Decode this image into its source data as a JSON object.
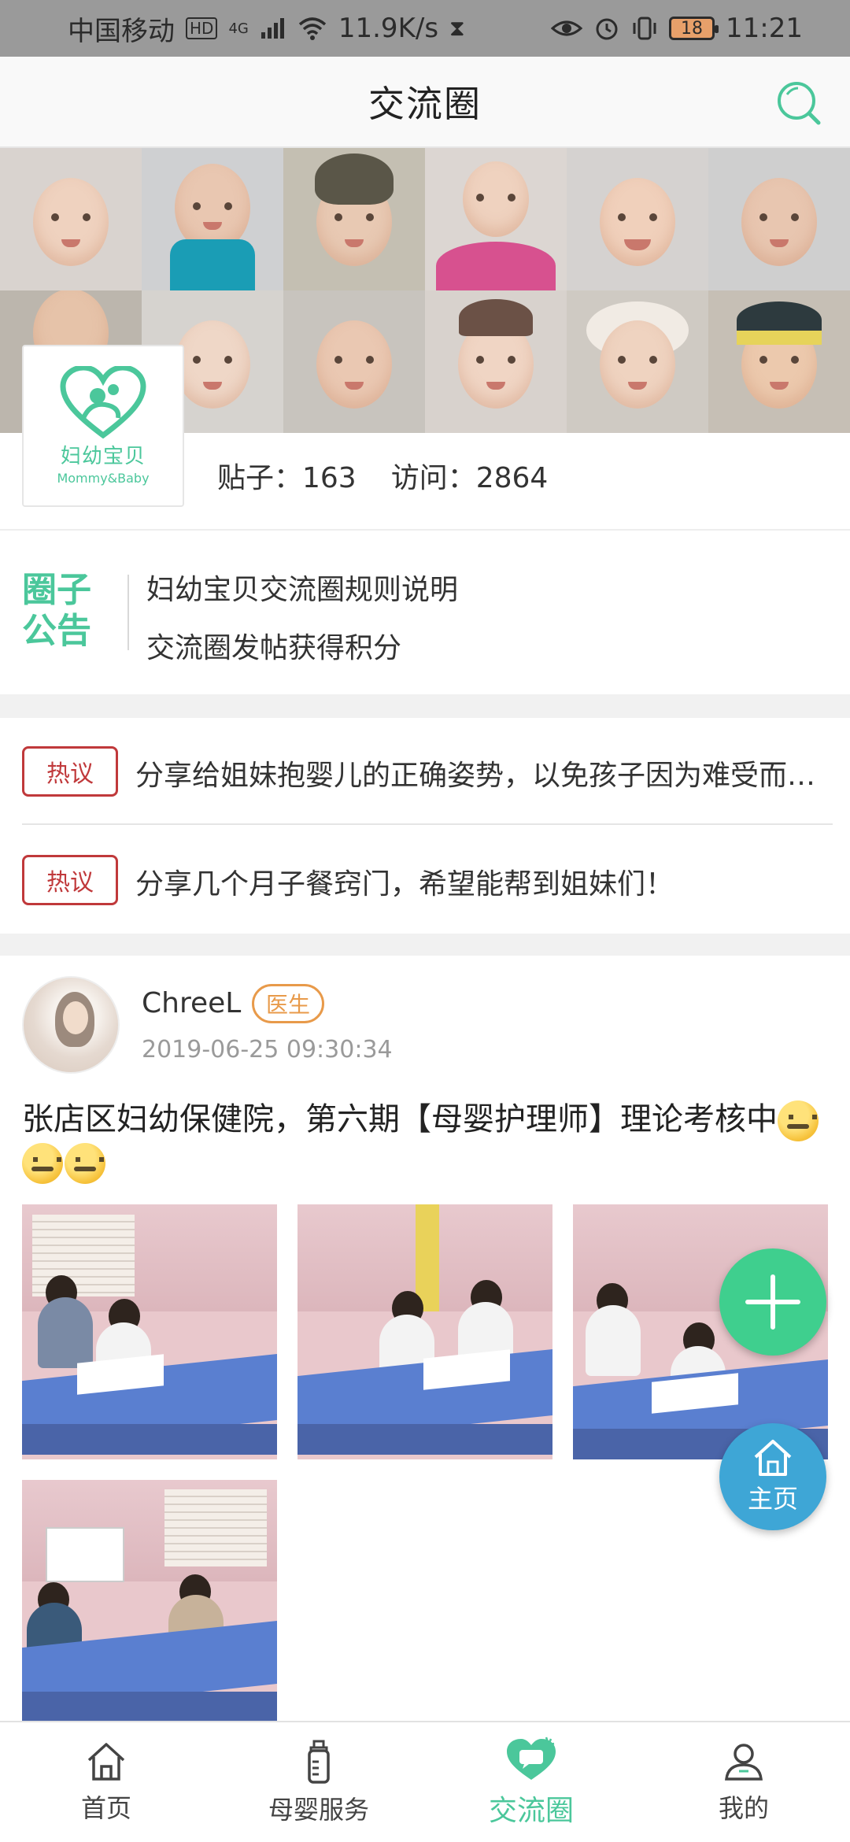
{
  "status_bar": {
    "carrier": "中国移动",
    "hd": "HD",
    "network": "4G",
    "speed": "11.9K/s",
    "battery": "18",
    "time": "11:21"
  },
  "header": {
    "title": "交流圈"
  },
  "circle": {
    "logo_cn": "妇幼宝贝",
    "logo_en": "Mommy&Baby",
    "posts_label": "贴子：163",
    "visits_label": "访问：2864"
  },
  "notice": {
    "tag_line1": "圈子",
    "tag_line2": "公告",
    "items": [
      "妇幼宝贝交流圈规则说明",
      "交流圈发帖获得积分"
    ]
  },
  "hot": {
    "badge": "热议",
    "items": [
      "分享给姐妹抱婴儿的正确姿势，以免孩子因为难受而哭闹",
      "分享几个月子餐窍门，希望能帮到姐妹们！"
    ]
  },
  "post": {
    "username": "ChreeL",
    "role": "医生",
    "time": "2019-06-25 09:30:34",
    "text": "张店区妇幼保健院，第六期【母婴护理师】理论考核中"
  },
  "fab": {
    "home_label": "主页"
  },
  "bottom_nav": {
    "items": [
      {
        "label": "首页",
        "icon": "home-icon"
      },
      {
        "label": "母婴服务",
        "icon": "baby-bottle-icon"
      },
      {
        "label": "交流圈",
        "icon": "chat-heart-icon"
      },
      {
        "label": "我的",
        "icon": "user-icon"
      }
    ],
    "active_index": 2
  },
  "colors": {
    "brand_green": "#4bc79b",
    "hot_red": "#c0393b",
    "doctor_orange": "#e89a4a",
    "fab_add": "#3fcf8e",
    "fab_home": "#3ea6d6"
  }
}
